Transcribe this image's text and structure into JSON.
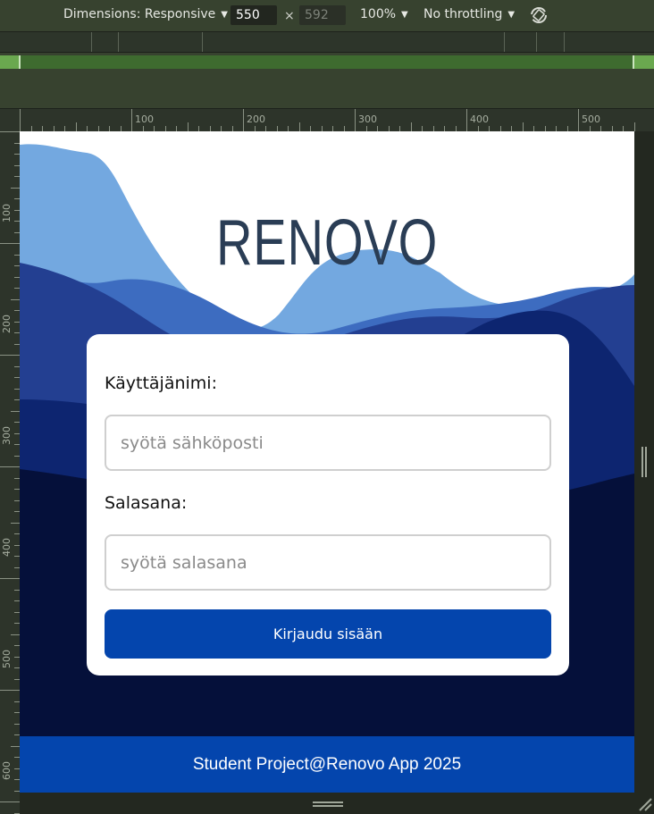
{
  "devtools": {
    "dimensions_label": "Dimensions: Responsive",
    "width_value": "550",
    "times": "×",
    "height_value": "592",
    "zoom": "100%",
    "throttling": "No throttling",
    "rotate_icon": "rotate-icon"
  },
  "ruler": {
    "top_labels": [
      "100",
      "200",
      "300",
      "400",
      "500"
    ],
    "left_labels": [
      "100",
      "200",
      "300",
      "400",
      "500",
      "600"
    ]
  },
  "app": {
    "logo": "RENOVO",
    "username_label": "Käyttäjänimi:",
    "username_placeholder": "syötä sähköposti",
    "password_label": "Salasana:",
    "password_placeholder": "syötä salasana",
    "login_button": "Kirjaudu sisään",
    "footer": "Student Project@Renovo App 2025"
  },
  "colors": {
    "primary": "#0445ad",
    "logo": "#2a3d55",
    "wave_light": "#73a8e0",
    "wave_mid": "#3d6cc0",
    "wave_dark": "#233f91",
    "wave_night": "#05103a"
  }
}
